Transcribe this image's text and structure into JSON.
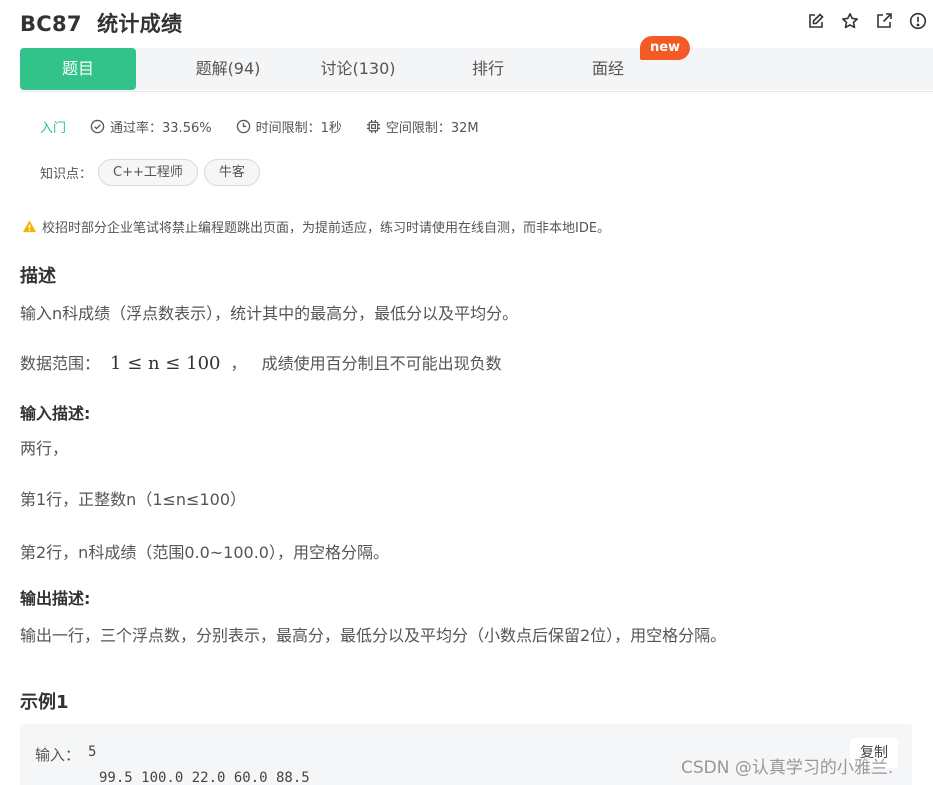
{
  "header": {
    "title": "BC87  统计成绩",
    "icons": [
      "edit-icon",
      "star-icon",
      "external-link-icon",
      "report-icon"
    ]
  },
  "tabs": [
    {
      "label": "题目",
      "active": true
    },
    {
      "label": "题解(94)",
      "active": false
    },
    {
      "label": "讨论(130)",
      "active": false
    },
    {
      "label": "排行",
      "active": false
    },
    {
      "label": "面经",
      "active": false
    }
  ],
  "new_badge": "new",
  "meta": {
    "level": "入门",
    "pass_rate": "通过率：33.56%",
    "time_limit": "时间限制：1秒",
    "space_limit": "空间限制：32M"
  },
  "knowledge": {
    "label": "知识点：",
    "tags": [
      "C++工程师",
      "牛客"
    ]
  },
  "notice": "校招时部分企业笔试将禁止编程题跳出页面，为提前适应，练习时请使用在线自测，而非本地IDE。",
  "description": {
    "heading": "描述",
    "line1": "输入n科成绩（浮点数表示），统计其中的最高分，最低分以及平均分。",
    "range_label": "数据范围：",
    "range_math": "1 ≤ n ≤ 100",
    "range_sep": "，",
    "range_text": "成绩使用百分制且不可能出现负数"
  },
  "input_desc": {
    "heading": "输入描述:",
    "line1": "两行，",
    "line2": "第1行，正整数n（1≤n≤100）",
    "line3": "第2行，n科成绩（范围0.0~100.0），用空格分隔。"
  },
  "output_desc": {
    "heading": "输出描述:",
    "line1": "输出一行，三个浮点数，分别表示，最高分，最低分以及平均分（小数点后保留2位），用空格分隔。"
  },
  "example": {
    "heading": "示例1",
    "input_label": "输入：",
    "input_line1": "5",
    "input_line2": "99.5 100.0 22.0 60.0 88.5",
    "copy_label": "复制"
  },
  "watermark": "CSDN @认真学习的小雅兰."
}
